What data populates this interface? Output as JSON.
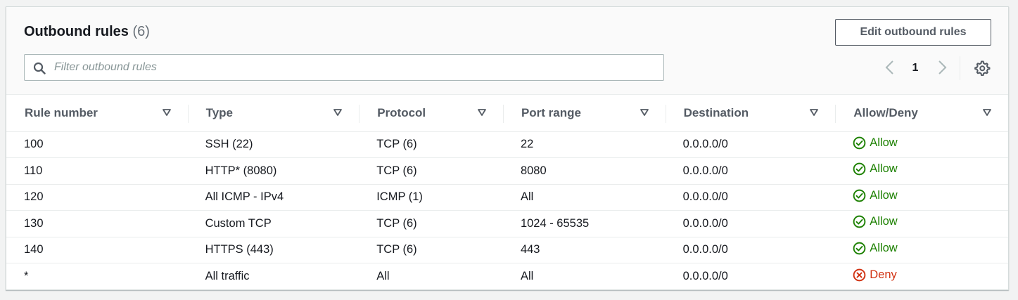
{
  "panel": {
    "title": "Outbound rules",
    "count": "(6)",
    "edit_button": "Edit outbound rules",
    "filter_placeholder": "Filter outbound rules",
    "page": "1"
  },
  "columns": [
    "Rule number",
    "Type",
    "Protocol",
    "Port range",
    "Destination",
    "Allow/Deny"
  ],
  "rows": [
    {
      "rule": "100",
      "type": "SSH (22)",
      "protocol": "TCP (6)",
      "port": "22",
      "destination": "0.0.0.0/0",
      "action": "Allow",
      "kind": "allow"
    },
    {
      "rule": "110",
      "type": "HTTP* (8080)",
      "protocol": "TCP (6)",
      "port": "8080",
      "destination": "0.0.0.0/0",
      "action": "Allow",
      "kind": "allow"
    },
    {
      "rule": "120",
      "type": "All ICMP - IPv4",
      "protocol": "ICMP (1)",
      "port": "All",
      "destination": "0.0.0.0/0",
      "action": "Allow",
      "kind": "allow"
    },
    {
      "rule": "130",
      "type": "Custom TCP",
      "protocol": "TCP (6)",
      "port": "1024 - 65535",
      "destination": "0.0.0.0/0",
      "action": "Allow",
      "kind": "allow"
    },
    {
      "rule": "140",
      "type": "HTTPS (443)",
      "protocol": "TCP (6)",
      "port": "443",
      "destination": "0.0.0.0/0",
      "action": "Allow",
      "kind": "allow"
    },
    {
      "rule": "*",
      "type": "All traffic",
      "protocol": "All",
      "port": "All",
      "destination": "0.0.0.0/0",
      "action": "Deny",
      "kind": "deny"
    }
  ],
  "icons": {
    "search": "search-icon",
    "prev": "chevron-left-icon",
    "next": "chevron-right-icon",
    "settings": "gear-icon",
    "sort": "caret-down-icon",
    "allow": "check-circle-icon",
    "deny": "x-circle-icon"
  },
  "colors": {
    "allow": "#1d8102",
    "deny": "#d13212",
    "header_text": "#545b64"
  }
}
